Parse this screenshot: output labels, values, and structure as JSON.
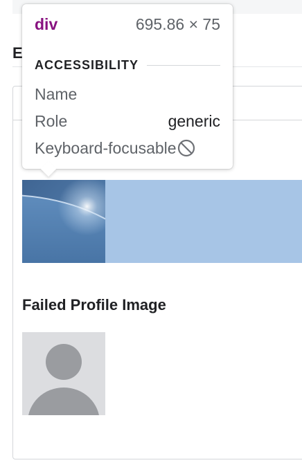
{
  "heading_fragment": "E",
  "section": {
    "failed_profile_title": "Failed Profile Image"
  },
  "tooltip": {
    "tag": "div",
    "dimensions": "695.86 × 75",
    "section_label": "ACCESSIBILITY",
    "rows": [
      {
        "label": "Name",
        "value": ""
      },
      {
        "label": "Role",
        "value": "generic"
      },
      {
        "label": "Keyboard-focusable",
        "icon": "not-allowed-icon"
      }
    ]
  },
  "colors": {
    "tag": "#881280",
    "banner": "#a7c5e6",
    "avatar_bg": "#dcdde0",
    "avatar_fg": "#9a9ca0"
  }
}
